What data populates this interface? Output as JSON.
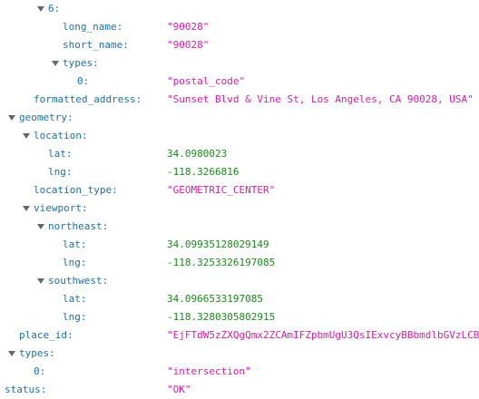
{
  "nodes": [
    {
      "key": "6:",
      "depth": 2,
      "expandable": true
    },
    {
      "key": "long_name:",
      "depth": 3,
      "value": "\"90028\"",
      "type": "string"
    },
    {
      "key": "short_name:",
      "depth": 3,
      "value": "\"90028\"",
      "type": "string"
    },
    {
      "key": "types:",
      "depth": 3,
      "expandable": true
    },
    {
      "key": "0:",
      "depth": 4,
      "value": "\"postal_code\"",
      "type": "string"
    },
    {
      "key": "formatted_address:",
      "depth": 1,
      "value": "\"Sunset Blvd & Vine St, Los Angeles, CA 90028, USA\"",
      "type": "string"
    },
    {
      "key": "geometry:",
      "depth": 0,
      "expandable": true
    },
    {
      "key": "location:",
      "depth": 1,
      "expandable": true
    },
    {
      "key": "lat:",
      "depth": 2,
      "value": "34.0980023",
      "type": "number"
    },
    {
      "key": "lng:",
      "depth": 2,
      "value": "-118.3266816",
      "type": "number"
    },
    {
      "key": "location_type:",
      "depth": 1,
      "value": "\"GEOMETRIC_CENTER\"",
      "type": "string"
    },
    {
      "key": "viewport:",
      "depth": 1,
      "expandable": true
    },
    {
      "key": "northeast:",
      "depth": 2,
      "expandable": true
    },
    {
      "key": "lat:",
      "depth": 3,
      "value": "34.09935128029149",
      "type": "number"
    },
    {
      "key": "lng:",
      "depth": 3,
      "value": "-118.3253326197085",
      "type": "number"
    },
    {
      "key": "southwest:",
      "depth": 2,
      "expandable": true
    },
    {
      "key": "lat:",
      "depth": 3,
      "value": "34.0966533197085",
      "type": "number"
    },
    {
      "key": "lng:",
      "depth": 3,
      "value": "-118.3280305802915",
      "type": "number"
    },
    {
      "key": "place_id:",
      "depth": 0,
      "value": "\"EjFTdW5zZXQgQmx2ZCAmIFZpbmUgU3QsIExvcyBBbmdlbGVzLCB",
      "type": "string"
    },
    {
      "key": "types:",
      "depth": 0,
      "expandable": true
    },
    {
      "key": "0:",
      "depth": 1,
      "value": "\"intersection\"",
      "type": "string"
    },
    {
      "key": "status:",
      "depth": -1,
      "value": "\"OK\"",
      "type": "string"
    }
  ],
  "colors": {
    "key": "#1f6fa8",
    "string": "#d321a5",
    "number": "#198a1a",
    "twisty": "#666666"
  },
  "icons": {
    "twisty": "triangle-down-icon"
  }
}
